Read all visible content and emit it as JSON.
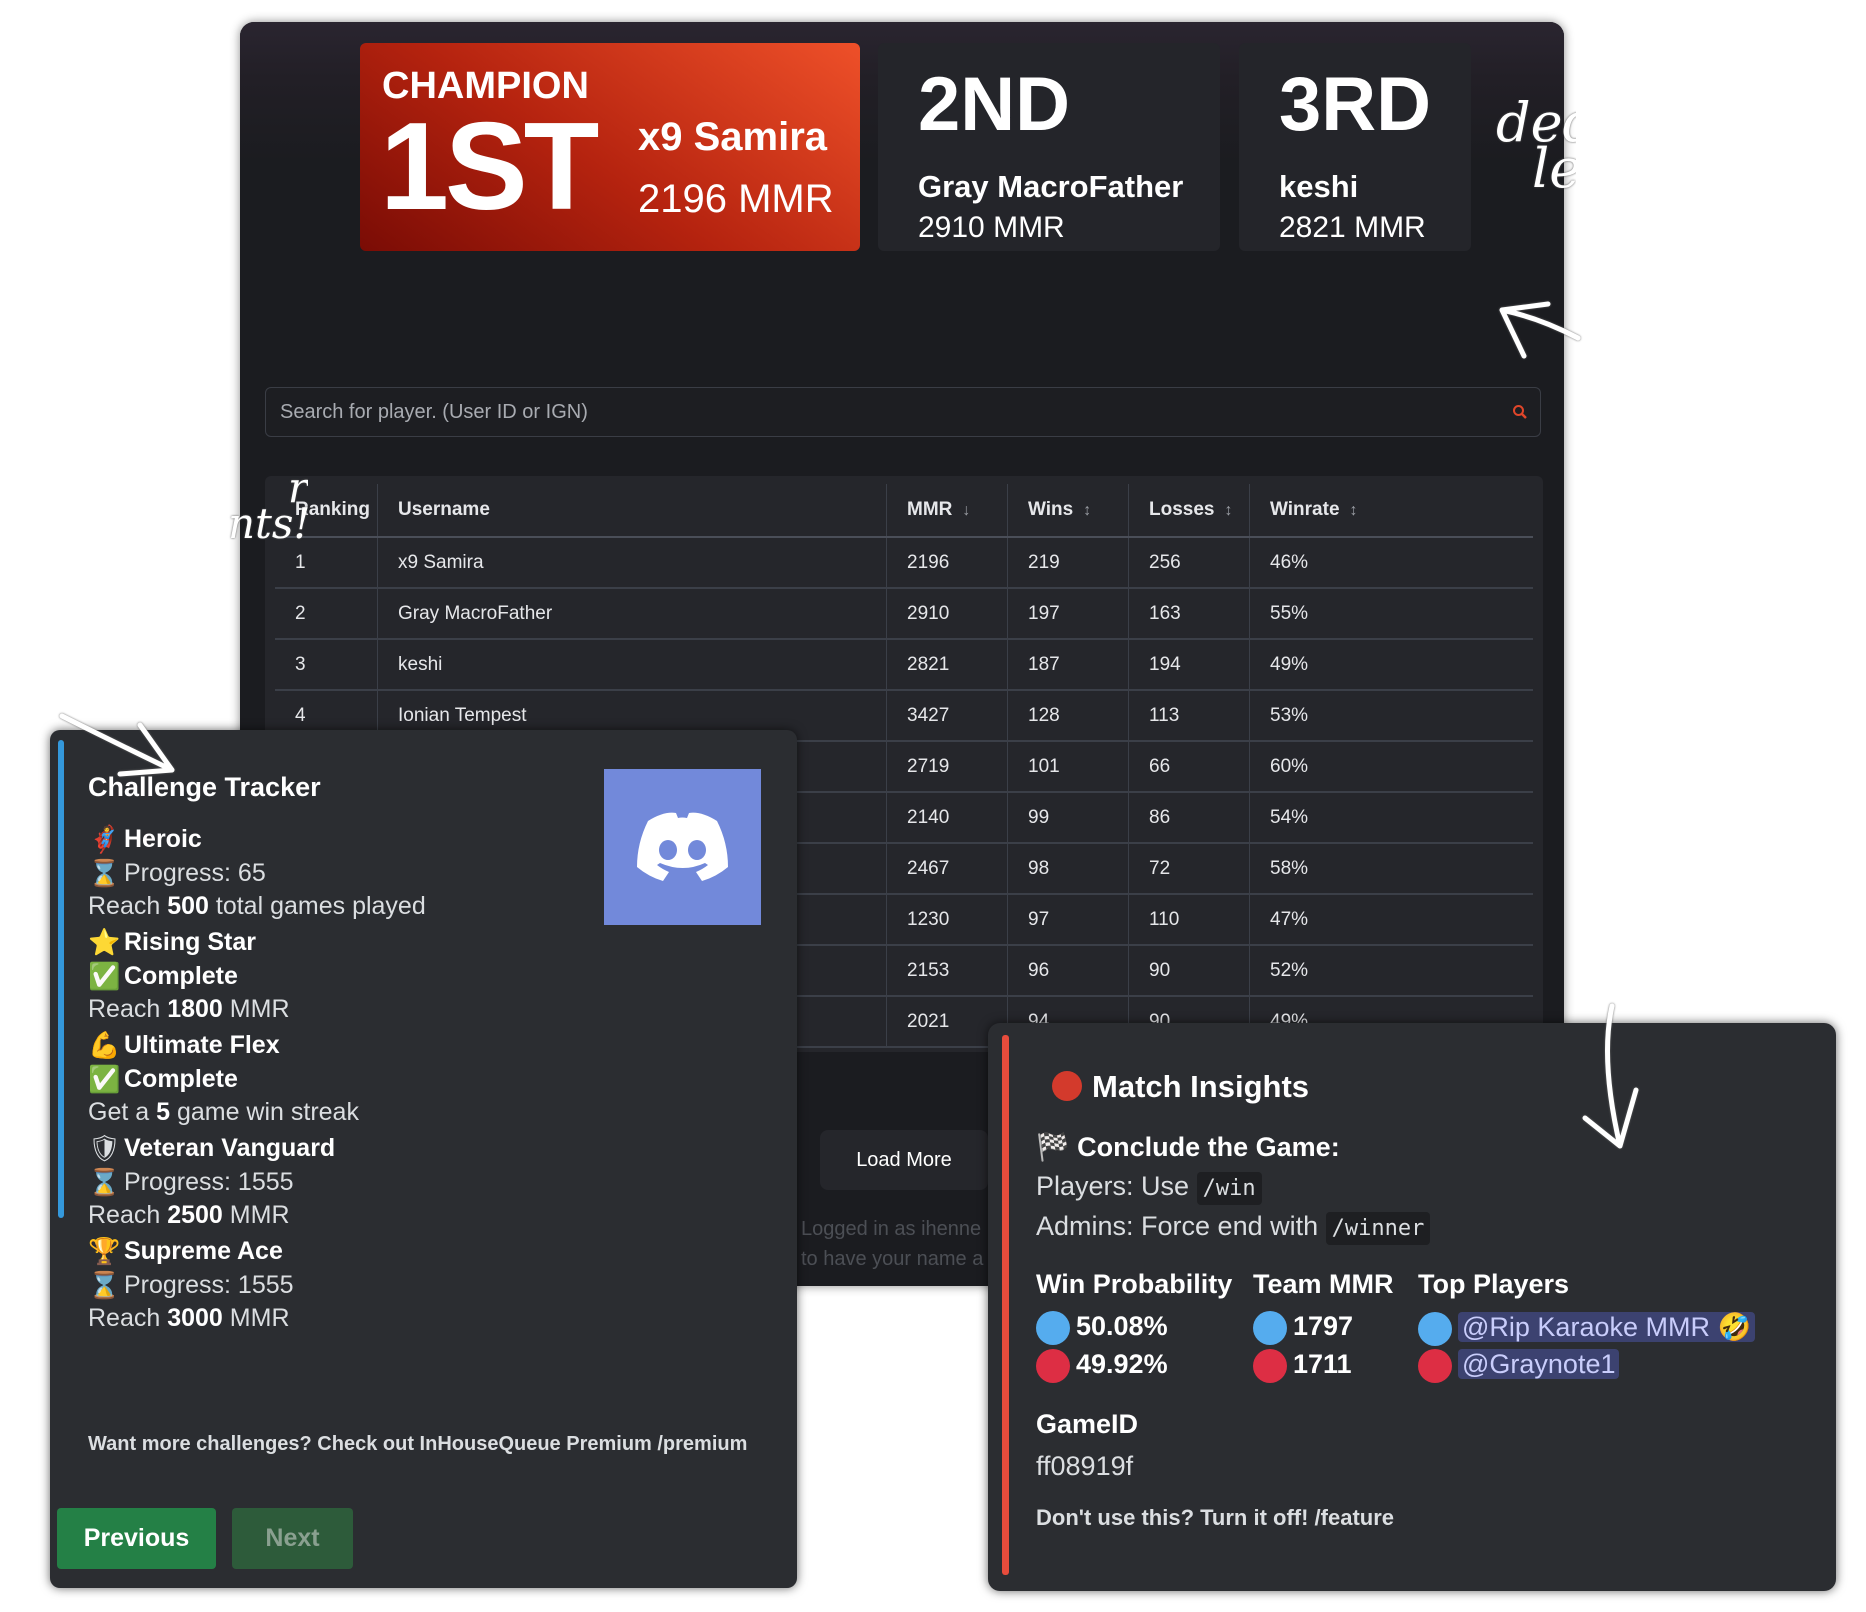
{
  "podium": {
    "champion_label": "CHAMPION",
    "first": {
      "place": "1ST",
      "name": "x9 Samira",
      "mmr": "2196 MMR"
    },
    "second": {
      "place": "2ND",
      "name": "Gray MacroFather",
      "mmr": "2910 MMR"
    },
    "third": {
      "place": "3RD",
      "name": "keshi",
      "mmr": "2821 MMR"
    }
  },
  "search": {
    "placeholder": "Search for player. (User ID or IGN)",
    "icon": "search-icon"
  },
  "table": {
    "headers": [
      "Ranking",
      "Username",
      "MMR",
      "Wins",
      "Losses",
      "Winrate"
    ],
    "sort_icons": [
      "",
      "",
      "↓",
      "↕",
      "↕",
      "↕"
    ],
    "rows": [
      [
        "1",
        "x9 Samira",
        "2196",
        "219",
        "256",
        "46%"
      ],
      [
        "2",
        "Gray MacroFather",
        "2910",
        "197",
        "163",
        "55%"
      ],
      [
        "3",
        "keshi",
        "2821",
        "187",
        "194",
        "49%"
      ],
      [
        "4",
        "Ionian Tempest",
        "3427",
        "128",
        "113",
        "53%"
      ],
      [
        "",
        "",
        "2719",
        "101",
        "66",
        "60%"
      ],
      [
        "",
        "",
        "2140",
        "99",
        "86",
        "54%"
      ],
      [
        "",
        "",
        "2467",
        "98",
        "72",
        "58%"
      ],
      [
        "",
        "",
        "1230",
        "97",
        "110",
        "47%"
      ],
      [
        "",
        "",
        "2153",
        "96",
        "90",
        "52%"
      ],
      [
        "",
        "",
        "2021",
        "94",
        "90",
        "49%"
      ]
    ]
  },
  "load_more": "Load More",
  "logged_in": [
    "Logged in as ihenne",
    "to have your name a"
  ],
  "challenge": {
    "title": "Challenge Tracker",
    "items": [
      {
        "icon": "superhero-icon",
        "emoji": "🦸",
        "name": "Heroic",
        "status_icon": "hourglass-icon",
        "status_emoji": "⌛",
        "status": "Progress: 65",
        "desc_pre": "Reach ",
        "desc_bold": "500",
        "desc_post": " total games played"
      },
      {
        "icon": "star-icon",
        "emoji": "⭐",
        "name": "Rising Star",
        "status_icon": "check-icon",
        "status_emoji": "✅",
        "status": "Complete",
        "desc_pre": "Reach ",
        "desc_bold": "1800",
        "desc_post": " MMR"
      },
      {
        "icon": "flexed-bicep-icon",
        "emoji": "💪",
        "name": "Ultimate Flex",
        "status_icon": "check-icon",
        "status_emoji": "✅",
        "status": "Complete",
        "desc_pre": "Get a ",
        "desc_bold": "5",
        "desc_post": " game win streak"
      },
      {
        "icon": "shield-icon",
        "emoji": "🛡",
        "name": "Veteran Vanguard",
        "status_icon": "hourglass-icon",
        "status_emoji": "⌛",
        "status": "Progress: 1555",
        "desc_pre": "Reach ",
        "desc_bold": "2500",
        "desc_post": " MMR"
      },
      {
        "icon": "trophy-icon",
        "emoji": "🏆",
        "name": "Supreme Ace",
        "status_icon": "hourglass-icon",
        "status_emoji": "⌛",
        "status": "Progress: 1555",
        "desc_pre": "Reach ",
        "desc_bold": "3000",
        "desc_post": " MMR"
      }
    ],
    "footer": "Want more challenges? Check out InHouseQueue Premium /premium",
    "prev": "Previous",
    "next": "Next"
  },
  "match": {
    "title": "Match Insights",
    "conclude": "Conclude the Game:",
    "players_text": "Players: Use",
    "players_cmd": "/win",
    "admins_text": "Admins: Force end with",
    "admins_cmd": "/winner",
    "headers": [
      "Win Probability",
      "Team MMR",
      "Top Players"
    ],
    "blue": {
      "prob": "50.08%",
      "mmr": "1797",
      "player": "@Rip Karaoke MMR 🤣"
    },
    "red": {
      "prob": "49.92%",
      "mmr": "1711",
      "player": "@Graynote1"
    },
    "gameid_label": "GameID",
    "gameid": "ff08919f",
    "footer": "Don't use this? Turn it off! /feature"
  },
  "annotations": {
    "right": [
      "ded",
      "lea"
    ],
    "left": [
      "r",
      "nts!"
    ]
  },
  "colors": {
    "champion": "#d0301a",
    "blue_team": "#55acee",
    "red_team": "#dd2e44",
    "challenge_bar": "#3498db",
    "match_bar": "#e74c3c",
    "discord": "#7289da",
    "prev_button": "#248046"
  }
}
